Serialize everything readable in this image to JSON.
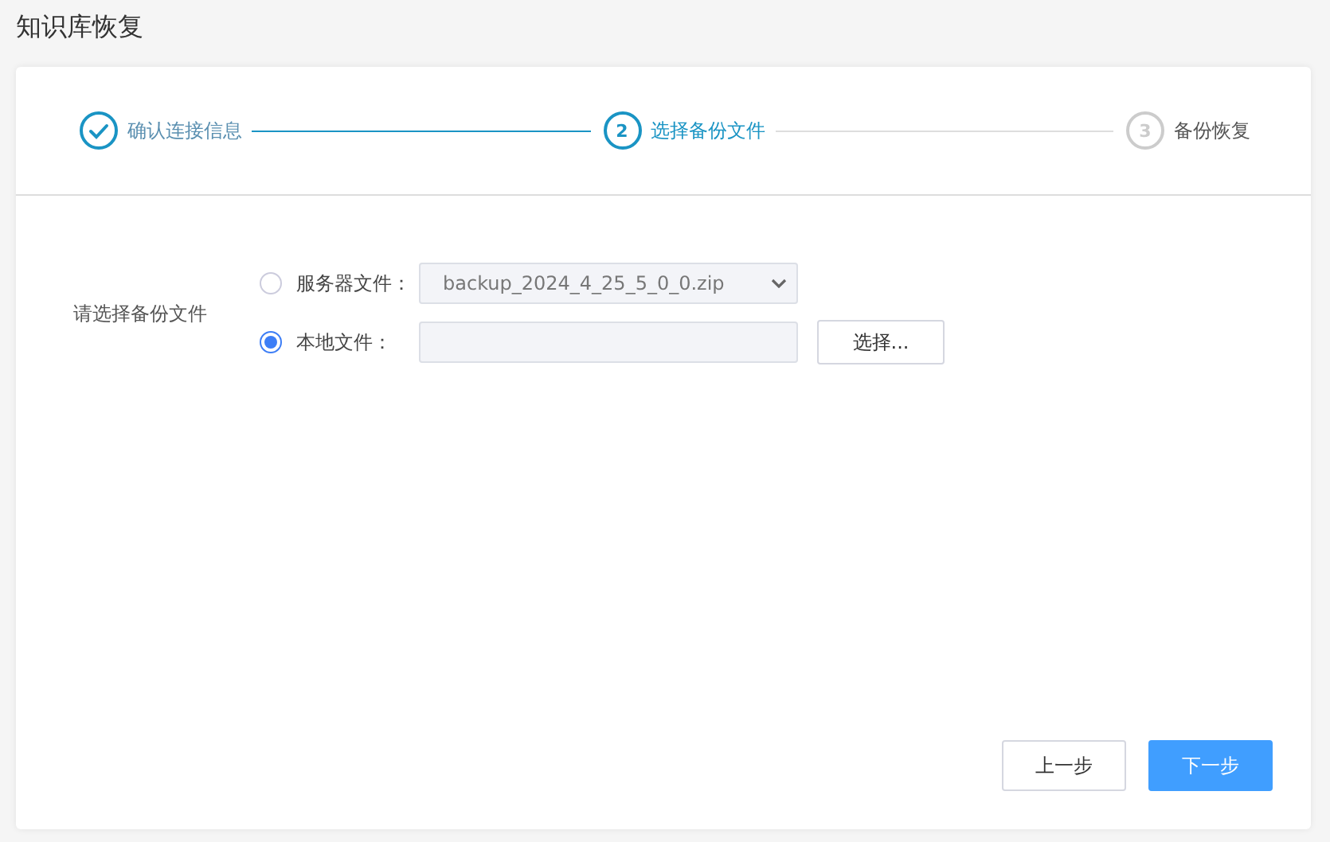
{
  "page_title": "知识库恢复",
  "steps": [
    {
      "label": "确认连接信息",
      "done": true,
      "selected": false
    },
    {
      "number": "2",
      "label": "选择备份文件",
      "done": false,
      "selected": true
    },
    {
      "number": "3",
      "label": "备份恢复",
      "done": false,
      "selected": false
    }
  ],
  "form": {
    "label": "请选择备份文件",
    "options": [
      {
        "kind": "select",
        "label": "服务器文件：",
        "selected": false,
        "value": "backup_2024_4_25_5_0_0.zip"
      },
      {
        "kind": "file",
        "label": "本地文件：",
        "selected": true,
        "button": "选择..."
      }
    ]
  },
  "buttons": [
    {
      "label": "上一步",
      "primary": false
    },
    {
      "label": "下一步",
      "primary": true
    }
  ]
}
